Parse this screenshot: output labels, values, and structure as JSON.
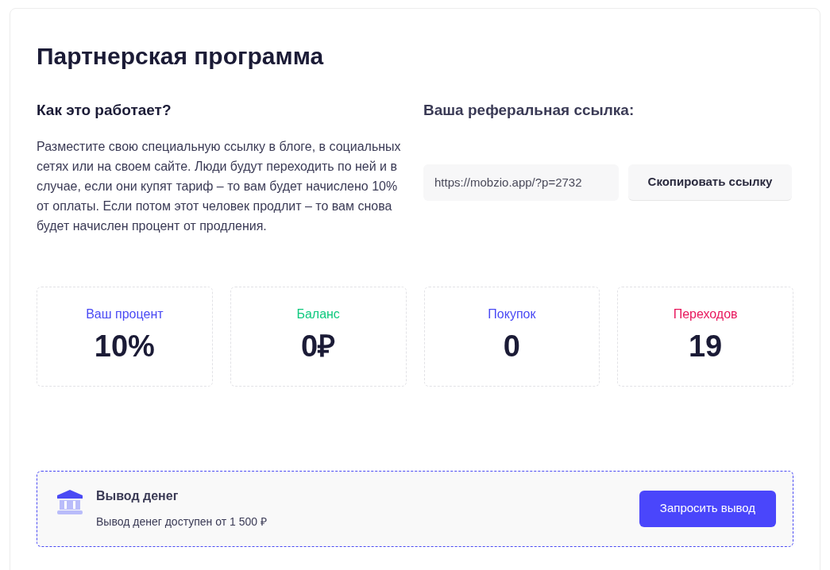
{
  "title": "Партнерская программа",
  "how": {
    "heading": "Как это работает?",
    "text": "Разместите свою специальную ссылку в блоге, в социальных сетях или на своем сайте. Люди будут переходить по ней и в случае, если они купят тариф – то вам будет начислено 10% от оплаты. Если потом этот человек продлит – то вам снова будет начислен процент от продления."
  },
  "referral": {
    "heading": "Ваша реферальная ссылка:",
    "link": "https://mobzio.app/?p=2732",
    "copy_button": "Скопировать ссылку"
  },
  "stats": [
    {
      "label": "Ваш процент",
      "value": "10%",
      "color": "#4a4af4"
    },
    {
      "label": "Баланс",
      "value": "0₽",
      "color": "#10c97f"
    },
    {
      "label": "Покупок",
      "value": "0",
      "color": "#4a4af4"
    },
    {
      "label": "Переходов",
      "value": "19",
      "color": "#e8175d"
    }
  ],
  "withdraw": {
    "title": "Вывод денег",
    "note": "Вывод денег доступен от 1 500 ₽",
    "button": "Запросить вывод"
  }
}
